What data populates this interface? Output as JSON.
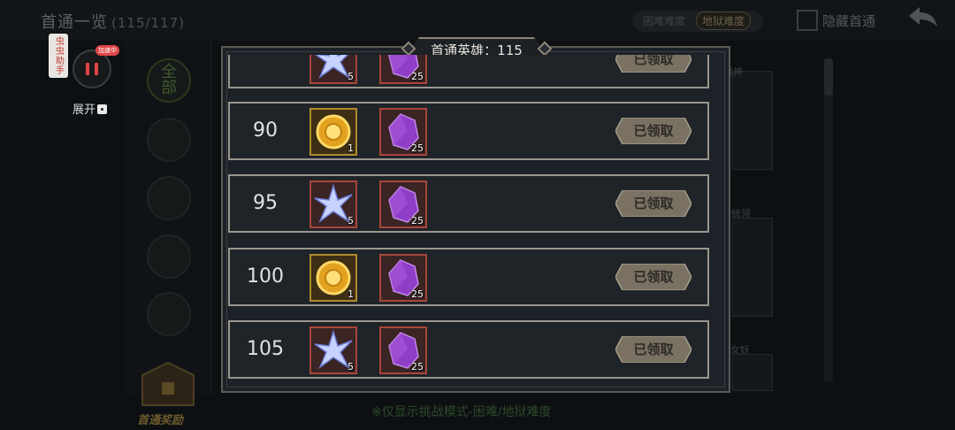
{
  "background": {
    "title": "首通一览",
    "count": "(115/117)",
    "difficulty_options": [
      "困难难度",
      "地狱难度"
    ],
    "hide_label": "隐藏首通",
    "faction_all": "全部",
    "reward_label": "首通奖励",
    "bottom_note": "※仅显示挑战模式-困难/地狱难度",
    "hero_names": [
      "魔神",
      "黄统领",
      "女妖"
    ]
  },
  "helper": {
    "tag": "虫虫助手",
    "badge": "加速中",
    "expand": "展开"
  },
  "modal": {
    "header": "首通英雄：115",
    "rows": [
      {
        "level": "",
        "item1": "star-shard",
        "qty1": "5",
        "qty2": "25",
        "status": "已领取"
      },
      {
        "level": "90",
        "item1": "gold-coin",
        "qty1": "1",
        "qty2": "25",
        "status": "已领取"
      },
      {
        "level": "95",
        "item1": "star-shard",
        "qty1": "5",
        "qty2": "25",
        "status": "已领取"
      },
      {
        "level": "100",
        "item1": "gold-coin",
        "qty1": "1",
        "qty2": "25",
        "status": "已领取"
      },
      {
        "level": "105",
        "item1": "star-shard",
        "qty1": "5",
        "qty2": "25",
        "status": "已领取"
      }
    ]
  },
  "colors": {
    "accent_gold": "#b08a2e",
    "claimed_button": "#7a7163",
    "crystal_purple": "#8e3ec7"
  }
}
